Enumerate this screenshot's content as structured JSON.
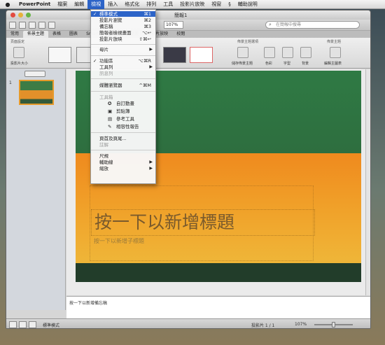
{
  "menubar": {
    "app": "PowerPoint",
    "items": [
      "檔案",
      "編輯",
      "檢視",
      "插入",
      "格式化",
      "排列",
      "工具",
      "投影片放映",
      "視窗",
      "輔助說明"
    ],
    "active_index": 2
  },
  "window": {
    "title": "簡報1",
    "zoom": "107%",
    "search_placeholder": "在簡報中搜尋"
  },
  "tabs": [
    "常用",
    "佈景主題",
    "表格",
    "圖表",
    "SmartArt",
    "轉場",
    "動畫",
    "投影片放映",
    "校閱"
  ],
  "ribbon": {
    "groups": [
      "頁面設定",
      "佈景主題選項",
      "佈景主題"
    ],
    "buttons": [
      "投影片大小",
      "儲存佈景主題",
      "色彩",
      "字型",
      "背景",
      "編輯主圖表"
    ]
  },
  "view_menu": {
    "items": [
      {
        "label": "標準模式",
        "shortcut": "⌘1",
        "checked": true,
        "selected": true
      },
      {
        "label": "投影片瀏覽",
        "shortcut": "⌘2"
      },
      {
        "label": "備忘稿",
        "shortcut": "⌘3"
      },
      {
        "label": "簡報者檢視畫面",
        "shortcut": "⌥↩"
      },
      {
        "label": "投影片放映",
        "shortcut": "⇧⌘↩"
      },
      {
        "label": "母片",
        "submenu": true
      },
      {
        "label": "功能區",
        "shortcut": "⌥⌘R",
        "checked": true
      },
      {
        "label": "工具列",
        "submenu": true
      },
      {
        "label": "訊息列",
        "disabled": true
      },
      {
        "label": "媒體瀏覽器",
        "shortcut": "^⌘M"
      },
      {
        "label": "工具箱",
        "disabled": true
      },
      {
        "label": "自訂動畫",
        "icon": "star"
      },
      {
        "label": "剪貼簿",
        "icon": "clipboard"
      },
      {
        "label": "參考工具",
        "icon": "book"
      },
      {
        "label": "相容性報告",
        "icon": "wrench"
      },
      {
        "label": "頁首及頁尾...",
        "disabled": false
      },
      {
        "label": "註解",
        "disabled": true
      },
      {
        "label": "尺規"
      },
      {
        "label": "輔助線",
        "submenu": true
      },
      {
        "label": "縮放",
        "submenu": true
      }
    ]
  },
  "slide": {
    "title_placeholder": "按一下以新增標題",
    "subtitle_placeholder": "按一下以新增子標題"
  },
  "notes_placeholder": "按一下以新增備忘稿",
  "status": {
    "view_label": "標準模式",
    "slide_count": "投影片 1 / 1",
    "zoom": "107%"
  },
  "slide_number": "1"
}
